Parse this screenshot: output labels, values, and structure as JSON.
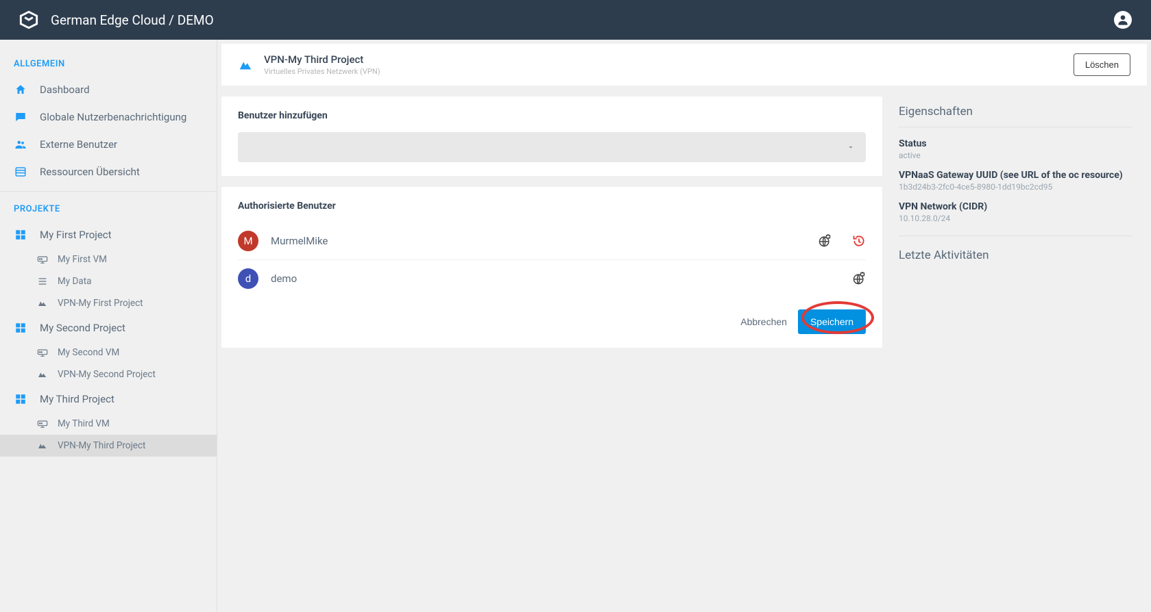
{
  "header": {
    "title": "German Edge Cloud / DEMO"
  },
  "sidebar": {
    "general_label": "ALLGEMEIN",
    "items": [
      {
        "label": "Dashboard"
      },
      {
        "label": "Globale Nutzerbenachrichtigung"
      },
      {
        "label": "Externe Benutzer"
      },
      {
        "label": "Ressourcen Übersicht"
      }
    ],
    "projects_label": "PROJEKTE",
    "projects": [
      {
        "label": "My First Project",
        "children": [
          {
            "label": "My First VM",
            "type": "vm"
          },
          {
            "label": "My Data",
            "type": "data"
          },
          {
            "label": "VPN-My First Project",
            "type": "vpn"
          }
        ]
      },
      {
        "label": "My Second Project",
        "children": [
          {
            "label": "My Second VM",
            "type": "vm"
          },
          {
            "label": "VPN-My Second Project",
            "type": "vpn"
          }
        ]
      },
      {
        "label": "My Third Project",
        "children": [
          {
            "label": "My Third VM",
            "type": "vm"
          },
          {
            "label": "VPN-My Third Project",
            "type": "vpn",
            "active": true
          }
        ]
      }
    ]
  },
  "page": {
    "title": "VPN-My Third Project",
    "subtitle": "Virtuelles Privates Netzwerk (VPN)",
    "delete_label": "Löschen"
  },
  "add_user": {
    "title": "Benutzer hinzufügen"
  },
  "auth_users": {
    "title": "Authorisierte Benutzer",
    "users": [
      {
        "initial": "M",
        "name": "MurmelMike",
        "color": "red",
        "removable": true
      },
      {
        "initial": "d",
        "name": "demo",
        "color": "blue",
        "removable": false
      }
    ],
    "cancel_label": "Abbrechen",
    "save_label": "Speichern"
  },
  "properties": {
    "header": "Eigenschaften",
    "items": [
      {
        "label": "Status",
        "value": "active"
      },
      {
        "label": "VPNaaS Gateway UUID (see URL of the oc resource)",
        "value": "1b3d24b3-2fc0-4ce5-8980-1dd19bc2cd95"
      },
      {
        "label": "VPN Network (CIDR)",
        "value": "10.10.28.0/24"
      }
    ],
    "activities_header": "Letzte Aktivitäten"
  }
}
